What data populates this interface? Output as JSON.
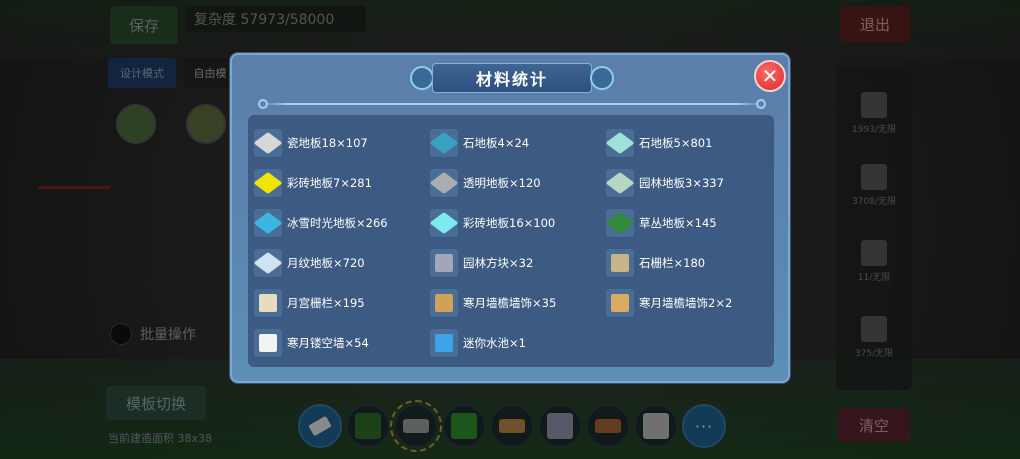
{
  "background": {
    "save_label": "保存",
    "complexity": "复杂度 57973/58000",
    "exit_label": "退出",
    "design_mode_label": "设计模式",
    "free_label": "自由模",
    "avatar1_caption": "",
    "avatar2_caption": "",
    "batch_label": "批量操作",
    "mode_switch_label": "模板切换",
    "area_label": "当前建造面积 38x38",
    "clear_label": "清空",
    "right_panel": [
      {
        "caption": "1993/无限"
      },
      {
        "caption": "3708/无限"
      },
      {
        "caption": "11/无限"
      },
      {
        "caption": "375/无限"
      }
    ],
    "hotbar": [
      {
        "icon": "eraser-icon"
      },
      {
        "icon": "grass-block-icon",
        "color": "#2f6b2a"
      },
      {
        "icon": "stone-slab-icon",
        "color": "#9a9a9a",
        "selected": true
      },
      {
        "icon": "grass-block-icon",
        "color": "#2f8a2a"
      },
      {
        "icon": "wood-floor-icon",
        "color": "#b9823f"
      },
      {
        "icon": "stone-block-icon",
        "color": "#8e8ea8"
      },
      {
        "icon": "wood-floor-icon",
        "color": "#a36235"
      },
      {
        "icon": "stone-block-icon",
        "color": "#b5b5b5"
      },
      {
        "icon": "more-icon",
        "label": "···"
      }
    ]
  },
  "dialog": {
    "title": "材料统计",
    "close_label": "✕",
    "materials": [
      {
        "label": "瓷地板18×107",
        "icon": "tile-floor-icon",
        "color": "#d8d8d8"
      },
      {
        "label": "石地板4×24",
        "icon": "stone-floor-icon",
        "color": "#3aa1c2"
      },
      {
        "label": "石地板5×801",
        "icon": "stone-floor-icon",
        "color": "#9ee2d8"
      },
      {
        "label": "彩砖地板7×281",
        "icon": "colored-brick-floor-icon",
        "color": "#f2e500"
      },
      {
        "label": "透明地板×120",
        "icon": "glass-floor-icon",
        "color": "#a9aeb3"
      },
      {
        "label": "园林地板3×337",
        "icon": "garden-floor-icon",
        "color": "#b6d7c3"
      },
      {
        "label": "冰雪时光地板×266",
        "icon": "ice-floor-icon",
        "color": "#3bb6e2"
      },
      {
        "label": "彩砖地板16×100",
        "icon": "colored-brick-floor-icon",
        "color": "#7ee9ee"
      },
      {
        "label": "草丛地板×145",
        "icon": "grass-floor-icon",
        "color": "#2f8a3a"
      },
      {
        "label": "月纹地板×720",
        "icon": "moon-pattern-floor-icon",
        "color": "#cfe3f2"
      },
      {
        "label": "园林方块×32",
        "icon": "garden-block-icon",
        "color": "#a3a6b8"
      },
      {
        "label": "石栅栏×180",
        "icon": "stone-fence-icon",
        "color": "#c7b489"
      },
      {
        "label": "月宫栅栏×195",
        "icon": "moon-palace-fence-icon",
        "color": "#e8dcc0"
      },
      {
        "label": "寒月墙檐墙饰×35",
        "icon": "wall-eave-icon",
        "color": "#d0a15a"
      },
      {
        "label": "寒月墙檐墙饰2×2",
        "icon": "wall-eave-icon",
        "color": "#d8aa62"
      },
      {
        "label": "寒月镂空墙×54",
        "icon": "hollow-wall-icon",
        "color": "#f2f2f2"
      },
      {
        "label": "迷你水池×1",
        "icon": "mini-pool-icon",
        "color": "#3ea3e8"
      }
    ]
  },
  "colors": {
    "dialog_bg": "#5b7eaa",
    "materials_box": "#3d5b82",
    "close_button": "#d62a2a"
  }
}
